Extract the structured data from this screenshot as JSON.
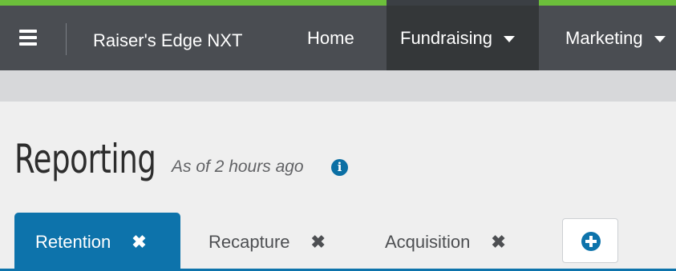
{
  "topnav": {
    "brand": "Raiser's Edge NXT",
    "items": [
      {
        "label": "Home"
      },
      {
        "label": "Fundraising",
        "active": true,
        "has_dropdown": true
      },
      {
        "label": "Marketing",
        "has_dropdown": true
      }
    ],
    "menu_icon": "hamburger-menu-icon"
  },
  "page": {
    "title": "Reporting",
    "as_of": "As of 2 hours ago",
    "info_icon": "info-icon"
  },
  "tabs": [
    {
      "label": "Retention",
      "active": true,
      "close_icon": "close-icon"
    },
    {
      "label": "Recapture",
      "active": false,
      "close_icon": "close-icon"
    },
    {
      "label": "Acquisition",
      "active": false,
      "close_icon": "close-icon"
    }
  ],
  "add_tab": {
    "icon": "plus-circle-icon"
  },
  "colors": {
    "accent_green": "#6cbf3b",
    "nav_background": "#4a4d52",
    "nav_active": "#343739",
    "primary_blue": "#0d73ab"
  }
}
